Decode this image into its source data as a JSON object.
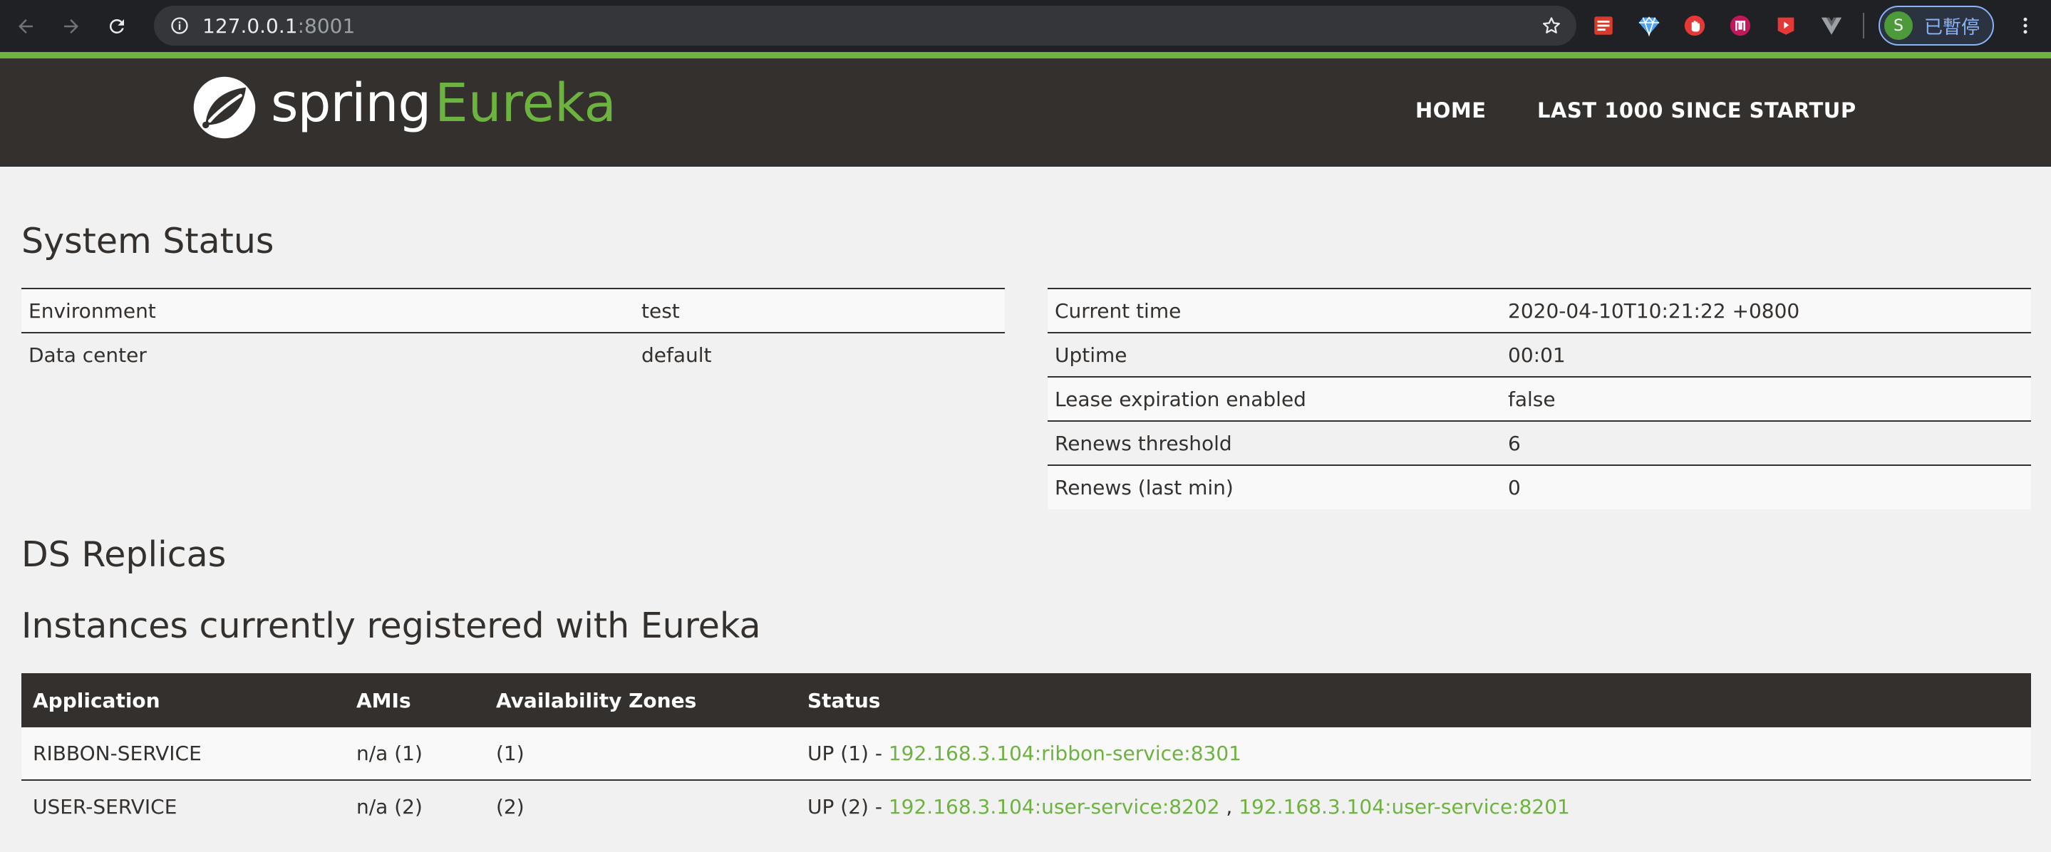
{
  "browser": {
    "url_host": "127.0.0.1",
    "url_port": ":8001",
    "profile_initial": "S",
    "profile_label": "已暫停",
    "extensions": [
      "notes-extension-icon",
      "gem-extension-icon",
      "hand-stop-extension-icon",
      "n-extension-icon",
      "play-extension-icon",
      "vue-extension-icon"
    ]
  },
  "header": {
    "logo_spring": "spring",
    "logo_eureka": "Eureka",
    "nav": [
      "HOME",
      "LAST 1000 SINCE STARTUP"
    ]
  },
  "system_status": {
    "title": "System Status",
    "left": [
      {
        "label": "Environment",
        "value": "test"
      },
      {
        "label": "Data center",
        "value": "default"
      }
    ],
    "right": [
      {
        "label": "Current time",
        "value": "2020-04-10T10:21:22 +0800"
      },
      {
        "label": "Uptime",
        "value": "00:01"
      },
      {
        "label": "Lease expiration enabled",
        "value": "false"
      },
      {
        "label": "Renews threshold",
        "value": "6"
      },
      {
        "label": "Renews (last min)",
        "value": "0"
      }
    ]
  },
  "ds_replicas": {
    "title": "DS Replicas"
  },
  "instances": {
    "title": "Instances currently registered with Eureka",
    "columns": [
      "Application",
      "AMIs",
      "Availability Zones",
      "Status"
    ],
    "rows": [
      {
        "application": "RIBBON-SERVICE",
        "amis": "n/a (1)",
        "zones": "(1)",
        "status_prefix": "UP (1) - ",
        "links": [
          "192.168.3.104:ribbon-service:8301"
        ]
      },
      {
        "application": "USER-SERVICE",
        "amis": "n/a (2)",
        "zones": "(2)",
        "status_prefix": "UP (2) - ",
        "links": [
          "192.168.3.104:user-service:8202",
          "192.168.3.104:user-service:8201"
        ],
        "link_separator": " , "
      }
    ]
  },
  "colors": {
    "brand_green": "#6db33f",
    "header_bg": "#34302d",
    "page_bg": "#f1f1f1"
  }
}
